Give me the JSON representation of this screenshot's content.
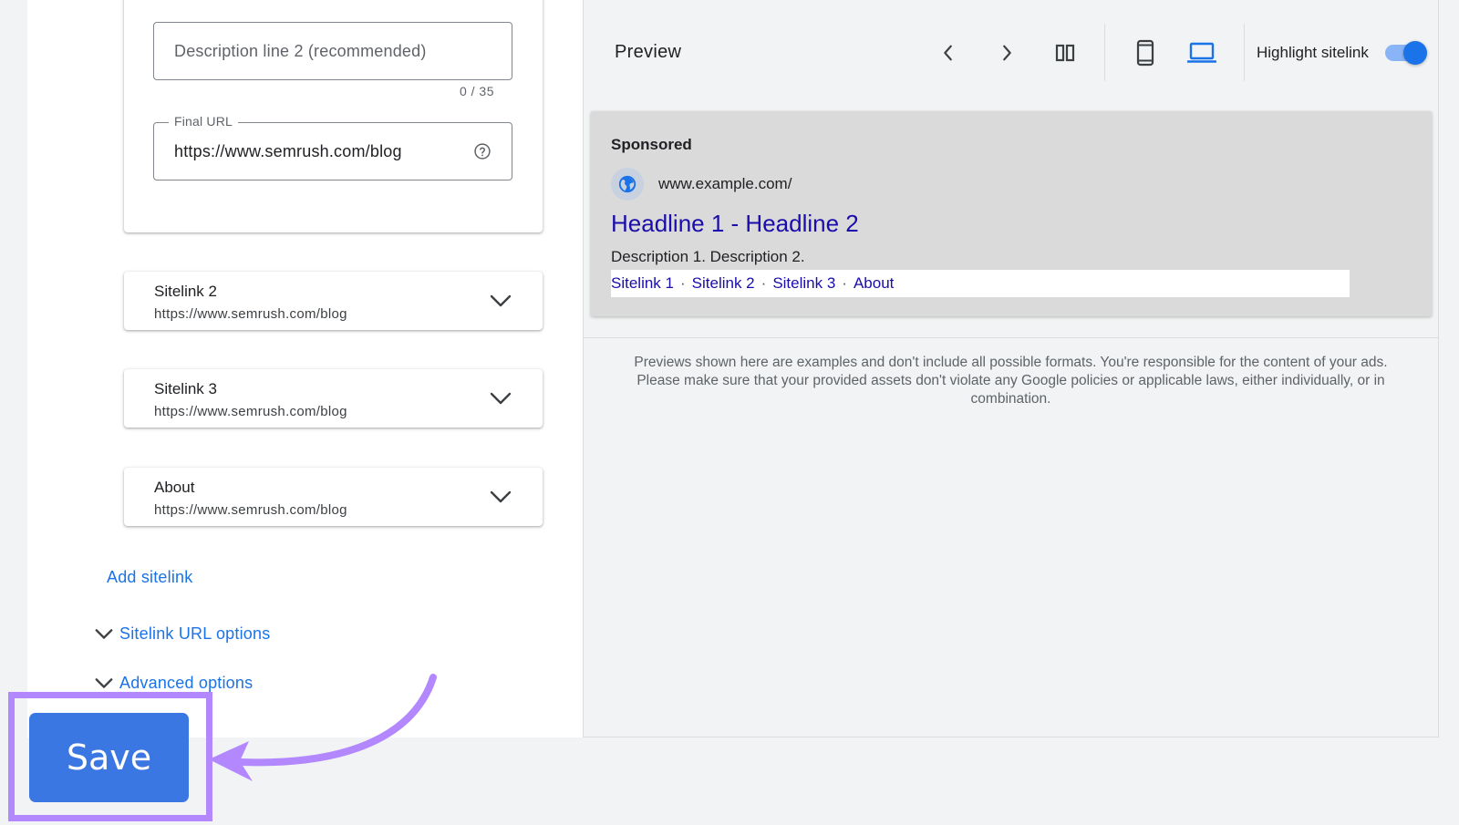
{
  "editor": {
    "description2": {
      "placeholder": "Description line 2 (recommended)",
      "char_count": "0 / 35"
    },
    "final_url": {
      "label": "Final URL",
      "value": "https://www.semrush.com/blog"
    },
    "sitelinks": [
      {
        "title": "Sitelink 2",
        "url": "https://www.semrush.com/blog"
      },
      {
        "title": "Sitelink 3",
        "url": "https://www.semrush.com/blog"
      },
      {
        "title": "About",
        "url": "https://www.semrush.com/blog"
      }
    ],
    "add_sitelink": "Add sitelink",
    "sitelink_url_options": "Sitelink URL options",
    "advanced_options": "Advanced options",
    "save_label": "Save"
  },
  "preview": {
    "title": "Preview",
    "highlight_label": "Highlight sitelink",
    "highlight_on": true,
    "ad": {
      "sponsored": "Sponsored",
      "display_url": "www.example.com/",
      "headline": "Headline 1 - Headline 2",
      "description": "Description 1. Description 2.",
      "sitelinks": [
        "Sitelink 1",
        "Sitelink 2",
        "Sitelink 3",
        "About"
      ],
      "separator": "·"
    },
    "disclaimer": "Previews shown here are examples and don't include all possible formats. You're responsible for the content of your ads. Please make sure that your provided assets don't violate any Google policies or applicable laws, either individually, or in combination."
  },
  "colors": {
    "accent": "#1a73e8",
    "save_button": "#3b77e3",
    "highlight_frame": "#b388ff",
    "ad_link": "#1a0dab"
  }
}
